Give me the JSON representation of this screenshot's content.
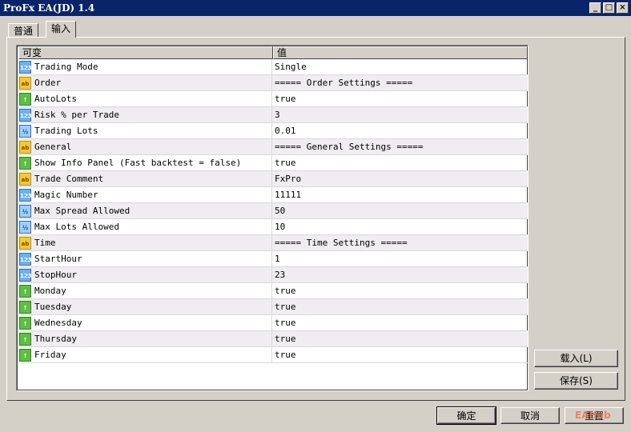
{
  "window": {
    "title": "ProFx EA(JD) 1.4"
  },
  "tabs": [
    {
      "label": "普通"
    },
    {
      "label": "输入"
    }
  ],
  "table": {
    "headers": [
      "可变",
      "值"
    ],
    "rows": [
      {
        "type": "int",
        "icon": "123",
        "name": "Trading Mode",
        "value": "Single"
      },
      {
        "type": "str",
        "icon": "ab",
        "name": "Order",
        "value": "===== Order Settings ====="
      },
      {
        "type": "bool",
        "icon": "↑",
        "name": "AutoLots",
        "value": "true"
      },
      {
        "type": "int",
        "icon": "123",
        "name": "Risk % per Trade",
        "value": "3"
      },
      {
        "type": "dbl",
        "icon": "½",
        "name": "Trading Lots",
        "value": "0.01"
      },
      {
        "type": "str",
        "icon": "ab",
        "name": "General",
        "value": "===== General Settings ====="
      },
      {
        "type": "bool",
        "icon": "↑",
        "name": "Show Info Panel (Fast backtest = false)",
        "value": "true"
      },
      {
        "type": "str",
        "icon": "ab",
        "name": "Trade Comment",
        "value": "FxPro"
      },
      {
        "type": "int",
        "icon": "123",
        "name": "Magic Number",
        "value": "11111"
      },
      {
        "type": "dbl",
        "icon": "½",
        "name": "Max Spread Allowed",
        "value": "50"
      },
      {
        "type": "dbl",
        "icon": "½",
        "name": "Max Lots Allowed",
        "value": "10"
      },
      {
        "type": "str",
        "icon": "ab",
        "name": "Time",
        "value": "===== Time Settings ====="
      },
      {
        "type": "int",
        "icon": "123",
        "name": "StartHour",
        "value": "1"
      },
      {
        "type": "int",
        "icon": "123",
        "name": "StopHour",
        "value": "23"
      },
      {
        "type": "bool",
        "icon": "↑",
        "name": "Monday",
        "value": "true"
      },
      {
        "type": "bool",
        "icon": "↑",
        "name": "Tuesday",
        "value": "true"
      },
      {
        "type": "bool",
        "icon": "↑",
        "name": "Wednesday",
        "value": "true"
      },
      {
        "type": "bool",
        "icon": "↑",
        "name": "Thursday",
        "value": "true"
      },
      {
        "type": "bool",
        "icon": "↑",
        "name": "Friday",
        "value": "true"
      }
    ]
  },
  "buttons": {
    "load": "载入(L)",
    "save": "保存(S)",
    "ok": "确定",
    "cancel": "取消",
    "reset": "重置"
  },
  "watermark": "EAHub"
}
